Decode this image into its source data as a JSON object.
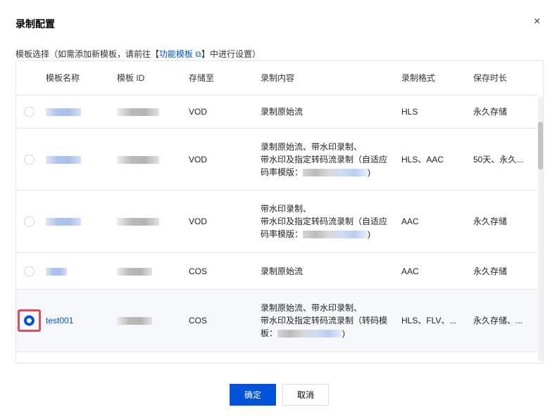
{
  "dialog": {
    "title": "录制配置",
    "close_icon": "×"
  },
  "hint": {
    "prefix": "模板选择（如需添加新模板，请前往【",
    "link": "功能模板",
    "suffix": "】中进行设置）"
  },
  "columns": [
    "模板名称",
    "模板 ID",
    "存储至",
    "录制内容",
    "录制格式",
    "保存时长"
  ],
  "rows": [
    {
      "name": "",
      "storage": "VOD",
      "content": [
        "录制原始流"
      ],
      "format": "HLS",
      "retention": "永久存储",
      "selected": false
    },
    {
      "name": "",
      "storage": "VOD",
      "content": [
        "录制原始流、带水印录制、",
        "带水印及指定转码流录制（自适应",
        "码率模版：",
        ")"
      ],
      "format": "HLS、AAC",
      "retention": "50天、永久...",
      "selected": false
    },
    {
      "name": "",
      "storage": "VOD",
      "content": [
        "带水印录制、",
        "带水印及指定转码流录制（自适应",
        "码率模版：",
        ")"
      ],
      "format": "AAC",
      "retention": "永久存储",
      "selected": false
    },
    {
      "name": "",
      "storage": "COS",
      "content": [
        "录制原始流"
      ],
      "format": "AAC",
      "retention": "永久存储",
      "selected": false
    },
    {
      "name": "test001",
      "storage": "COS",
      "content": [
        "录制原始流、带水印录制、",
        "带水印及指定转码流录制（转码模",
        "板：",
        ")"
      ],
      "format": "HLS、FLV、...",
      "retention": "永久存储、...",
      "selected": true
    }
  ],
  "buttons": {
    "ok": "确定",
    "cancel": "取消"
  },
  "colors": {
    "accent": "#0052d9",
    "highlight": "#e34d59"
  }
}
